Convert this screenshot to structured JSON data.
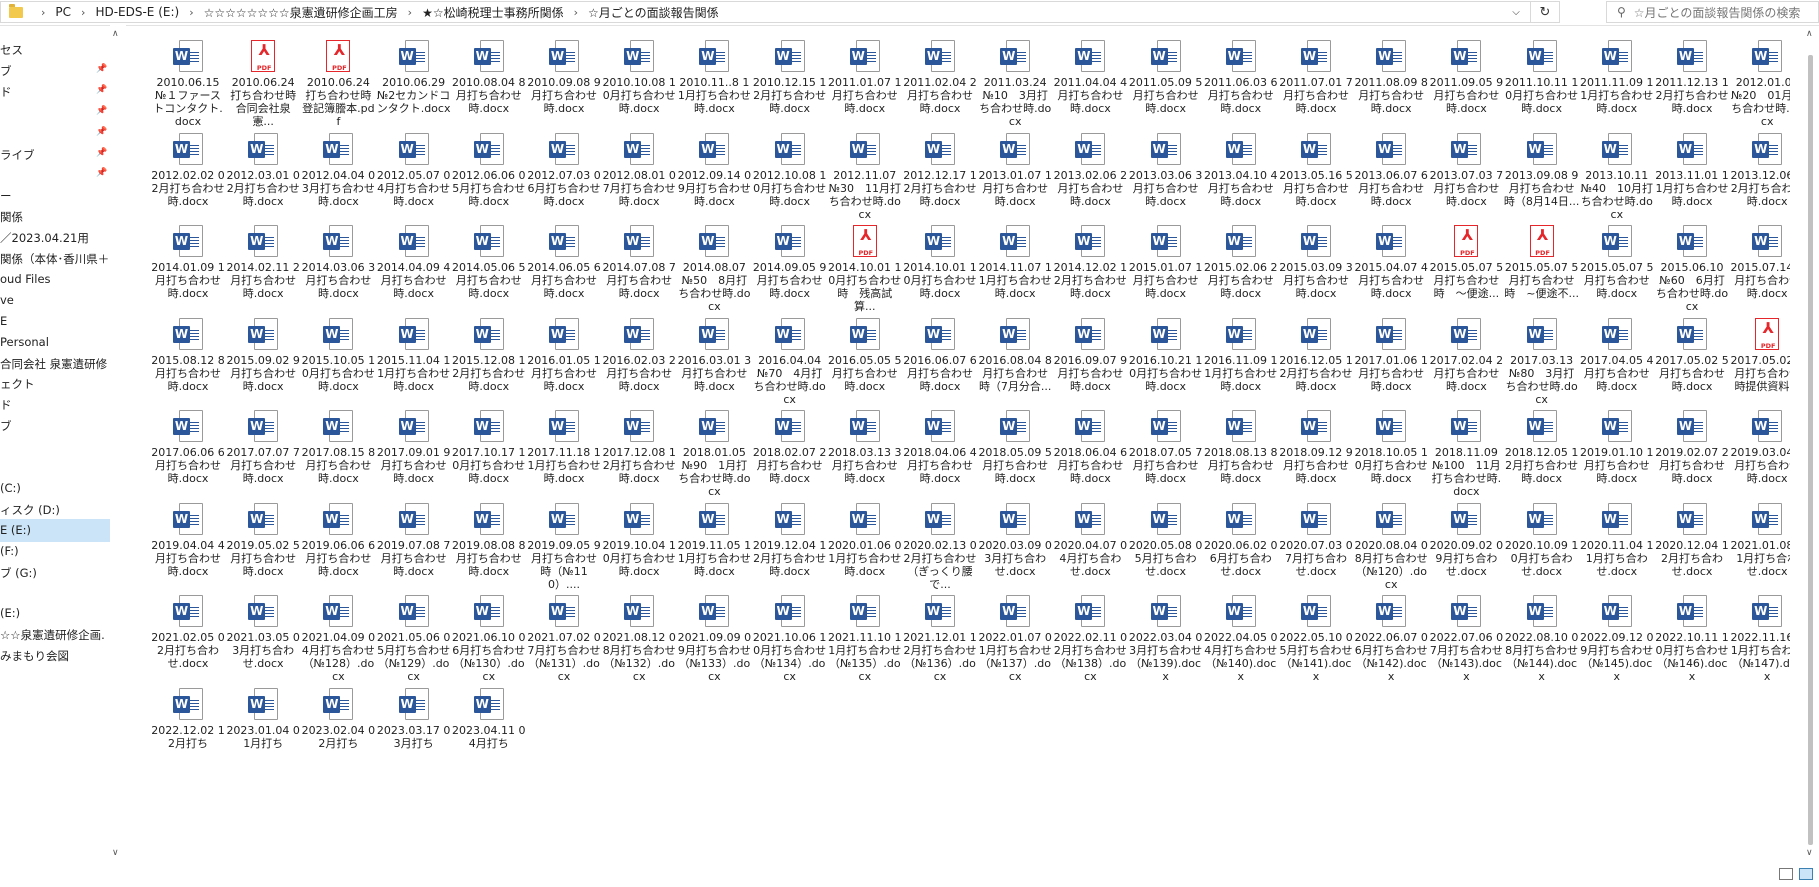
{
  "address": {
    "segments": [
      "PC",
      "HD-EDS-E (E:)",
      "☆☆☆☆☆☆☆☆泉憲遺研修企画工房",
      "★☆松崎税理士事務所関係",
      "☆月ごとの面談報告関係"
    ]
  },
  "search": {
    "placeholder": "☆月ごとの面談報告関係の検索"
  },
  "nav": {
    "items": [
      {
        "label": "セス",
        "pinned": false
      },
      {
        "label": "ブ",
        "pinned": true
      },
      {
        "label": "ド",
        "pinned": true
      },
      {
        "label": "",
        "pinned": true
      },
      {
        "label": "",
        "pinned": true
      },
      {
        "label": "ライブ",
        "pinned": true
      },
      {
        "label": "",
        "pinned": true
      },
      {
        "label": "ー",
        "pinned": false
      },
      {
        "label": "関係",
        "pinned": false
      },
      {
        "label": "／2023.04.21用",
        "pinned": false
      },
      {
        "label": "関係（本体･香川県＋",
        "pinned": false
      },
      {
        "label": "oud Files",
        "pinned": false
      },
      {
        "label": "ve",
        "pinned": false
      },
      {
        "label": "E",
        "pinned": false
      },
      {
        "label": " Personal",
        "pinned": false
      },
      {
        "label": "合同会社 泉憲遺研修",
        "pinned": false
      },
      {
        "label": "ェクト",
        "pinned": false
      },
      {
        "label": "ド",
        "pinned": false
      },
      {
        "label": "ブ",
        "pinned": false
      },
      {
        "label": "",
        "pinned": false
      },
      {
        "label": "",
        "pinned": false
      },
      {
        "label": "(C:)",
        "pinned": false
      },
      {
        "label": "ィスク (D:)",
        "pinned": false
      },
      {
        "label": "E (E:)",
        "pinned": false,
        "selected": true
      },
      {
        "label": "(F:)",
        "pinned": false
      },
      {
        "label": "ブ (G:)",
        "pinned": false
      },
      {
        "label": "",
        "pinned": false
      },
      {
        "label": "(E:)",
        "pinned": false
      },
      {
        "label": "☆☆泉憲遺研修企画.",
        "pinned": false
      },
      {
        "label": "みまもり会図",
        "pinned": false
      }
    ]
  },
  "files": [
    {
      "type": "word",
      "name": "2010.06.15 №１ファーストコンタクト.docx"
    },
    {
      "type": "pdf",
      "name": "2010.06.24 打ち合わせ時　合同会社泉憲..."
    },
    {
      "type": "pdf",
      "name": "2010.06.24 打ち合わせ時　登記簿謄本.pdf"
    },
    {
      "type": "word",
      "name": "2010.06.29 №2セカンドコンタクト.docx"
    },
    {
      "type": "word",
      "name": "2010.08.04 8月打ち合わせ時.docx"
    },
    {
      "type": "word",
      "name": "2010.09.08 9月打ち合わせ時.docx"
    },
    {
      "type": "word",
      "name": "2010.10.08 10月打ち合わせ時.docx"
    },
    {
      "type": "word",
      "name": "2010.11..8 11月打ち合わせ時.docx"
    },
    {
      "type": "word",
      "name": "2010.12.15 12月打ち合わせ時.docx"
    },
    {
      "type": "word",
      "name": "2011.01.07 1月打ち合わせ時.docx"
    },
    {
      "type": "word",
      "name": "2011.02.04 2月打ち合わせ時.docx"
    },
    {
      "type": "word",
      "name": "2011.03.24 №10　3月打ち合わせ時.docx"
    },
    {
      "type": "word",
      "name": "2011.04.04 4月打ち合わせ時.docx"
    },
    {
      "type": "word",
      "name": "2011.05.09 5月打ち合わせ時.docx"
    },
    {
      "type": "word",
      "name": "2011.06.03 6月打ち合わせ時.docx"
    },
    {
      "type": "word",
      "name": "2011.07.01 7月打ち合わせ時.docx"
    },
    {
      "type": "word",
      "name": "2011.08.09 8月打ち合わせ時.docx"
    },
    {
      "type": "word",
      "name": "2011.09.05 9月打ち合わせ時.docx"
    },
    {
      "type": "word",
      "name": "2011.10.11 10月打ち合わせ時.docx"
    },
    {
      "type": "word",
      "name": "2011.11.09 11月打ち合わせ時.docx"
    },
    {
      "type": "word",
      "name": "2011.12.13 12月打ち合わせ時.docx"
    },
    {
      "type": "word",
      "name": "2012.01.04 №20　01月打ち合わせ時.docx"
    },
    {
      "type": "word",
      "name": "2012.02.02 02月打ち合わせ時.docx"
    },
    {
      "type": "word",
      "name": "2012.03.01 02月打ち合わせ時.docx"
    },
    {
      "type": "word",
      "name": "2012.04.04 03月打ち合わせ時.docx"
    },
    {
      "type": "word",
      "name": "2012.05.07 04月打ち合わせ時.docx"
    },
    {
      "type": "word",
      "name": "2012.06.06 05月打ち合わせ時.docx"
    },
    {
      "type": "word",
      "name": "2012.07.03 06月打ち合わせ時.docx"
    },
    {
      "type": "word",
      "name": "2012.08.01 07月打ち合わせ時.docx"
    },
    {
      "type": "word",
      "name": "2012.09.14 09月打ち合わせ時.docx"
    },
    {
      "type": "word",
      "name": "2012.10.08 10月打ち合わせ時.docx"
    },
    {
      "type": "word",
      "name": "2012.11.07 №30　11月打ち合わせ時.docx"
    },
    {
      "type": "word",
      "name": "2012.12.17 12月打ち合わせ時.docx"
    },
    {
      "type": "word",
      "name": "2013.01.07 1月打ち合わせ時.docx"
    },
    {
      "type": "word",
      "name": "2013.02.06 2月打ち合わせ時.docx"
    },
    {
      "type": "word",
      "name": "2013.03.06 3月打ち合わせ時.docx"
    },
    {
      "type": "word",
      "name": "2013.04.10 4月打ち合わせ時.docx"
    },
    {
      "type": "word",
      "name": "2013.05.16 5月打ち合わせ時.docx"
    },
    {
      "type": "word",
      "name": "2013.06.07 6月打ち合わせ時.docx"
    },
    {
      "type": "word",
      "name": "2013.07.03 7月打ち合わせ時.docx"
    },
    {
      "type": "word",
      "name": "2013.09.08 9月打ち合わせ時（8月14日..."
    },
    {
      "type": "word",
      "name": "2013.10.11 №40　10月打ち合わせ時.docx"
    },
    {
      "type": "word",
      "name": "2013.11.01 11月打ち合わせ時.docx"
    },
    {
      "type": "word",
      "name": "2013.12.06 12月打ち合わせ時.docx"
    },
    {
      "type": "word",
      "name": "2014.01.09 1月打ち合わせ時.docx"
    },
    {
      "type": "word",
      "name": "2014.02.11 2月打ち合わせ時.docx"
    },
    {
      "type": "word",
      "name": "2014.03.06 3月打ち合わせ時.docx"
    },
    {
      "type": "word",
      "name": "2014.04.09 4月打ち合わせ時.docx"
    },
    {
      "type": "word",
      "name": "2014.05.06 5月打ち合わせ時.docx"
    },
    {
      "type": "word",
      "name": "2014.06.05 6月打ち合わせ時.docx"
    },
    {
      "type": "word",
      "name": "2014.07.08 7月打ち合わせ時.docx"
    },
    {
      "type": "word",
      "name": "2014.08.07 №50　8月打ち合わせ時.docx"
    },
    {
      "type": "word",
      "name": "2014.09.05 9月打ち合わせ時.docx"
    },
    {
      "type": "pdf",
      "name": "2014.10.01 10月打ち合わせ時　残高試算..."
    },
    {
      "type": "word",
      "name": "2014.10.01 10月打ち合わせ時.docx"
    },
    {
      "type": "word",
      "name": "2014.11.07 11月打ち合わせ時.docx"
    },
    {
      "type": "word",
      "name": "2014.12.02 12月打ち合わせ時.docx"
    },
    {
      "type": "word",
      "name": "2015.01.07 1月打ち合わせ時.docx"
    },
    {
      "type": "word",
      "name": "2015.02.06 2月打ち合わせ時.docx"
    },
    {
      "type": "word",
      "name": "2015.03.09 3月打ち合わせ時.docx"
    },
    {
      "type": "word",
      "name": "2015.04.07 4月打ち合わせ時.docx"
    },
    {
      "type": "pdf",
      "name": "2015.05.07 5月打ち合わせ時　〜便途..."
    },
    {
      "type": "pdf",
      "name": "2015.05.07 5月打ち合わせ時　~便途不..."
    },
    {
      "type": "word",
      "name": "2015.05.07 5月打ち合わせ時.docx"
    },
    {
      "type": "word",
      "name": "2015.06.10 №60　6月打ち合わせ時.docx"
    },
    {
      "type": "word",
      "name": "2015.07.14 7月打ち合わせ時.docx"
    },
    {
      "type": "word",
      "name": "2015.08.12 8月打ち合わせ時.docx"
    },
    {
      "type": "word",
      "name": "2015.09.02 9月打ち合わせ時.docx"
    },
    {
      "type": "word",
      "name": "2015.10.05 10月打ち合わせ時.docx"
    },
    {
      "type": "word",
      "name": "2015.11.04 11月打ち合わせ時.docx"
    },
    {
      "type": "word",
      "name": "2015.12.08 12月打ち合わせ時.docx"
    },
    {
      "type": "word",
      "name": "2016.01.05 1月打ち合わせ時.docx"
    },
    {
      "type": "word",
      "name": "2016.02.03 2月打ち合わせ時.docx"
    },
    {
      "type": "word",
      "name": "2016.03.01 3月打ち合わせ時.docx"
    },
    {
      "type": "word",
      "name": "2016.04.04 №70　4月打ち合わせ時.docx"
    },
    {
      "type": "word",
      "name": "2016.05.05 5月打ち合わせ時.docx"
    },
    {
      "type": "word",
      "name": "2016.06.07 6月打ち合わせ時.docx"
    },
    {
      "type": "word",
      "name": "2016.08.04 8月打ち合わせ時（7月分合..."
    },
    {
      "type": "word",
      "name": "2016.09.07 9月打ち合わせ時.docx"
    },
    {
      "type": "word",
      "name": "2016.10.21 10月打ち合わせ時.docx"
    },
    {
      "type": "word",
      "name": "2016.11.09 11月打ち合わせ時.docx"
    },
    {
      "type": "word",
      "name": "2016.12.05 12月打ち合わせ時.docx"
    },
    {
      "type": "word",
      "name": "2017.01.06 1月打ち合わせ時.docx"
    },
    {
      "type": "word",
      "name": "2017.02.04 2月打ち合わせ時.docx"
    },
    {
      "type": "word",
      "name": "2017.03.13 №80　3月打ち合わせ時.docx"
    },
    {
      "type": "word",
      "name": "2017.04.05 4月打ち合わせ時.docx"
    },
    {
      "type": "word",
      "name": "2017.05.02 5月打ち合わせ時.docx"
    },
    {
      "type": "pdf",
      "name": "2017.05.02 5月打ち合わせ時提供資料..."
    },
    {
      "type": "word",
      "name": "2017.06.06 6月打ち合わせ時.docx"
    },
    {
      "type": "word",
      "name": "2017.07.07 7月打ち合わせ時.docx"
    },
    {
      "type": "word",
      "name": "2017.08.15 8月打ち合わせ時.docx"
    },
    {
      "type": "word",
      "name": "2017.09.01 9月打ち合わせ時.docx"
    },
    {
      "type": "word",
      "name": "2017.10.17 10月打ち合わせ時.docx"
    },
    {
      "type": "word",
      "name": "2017.11.18 11月打ち合わせ時.docx"
    },
    {
      "type": "word",
      "name": "2017.12.08 12月打ち合わせ時.docx"
    },
    {
      "type": "word",
      "name": "2018.01.05 №90　1月打ち合わせ時.docx"
    },
    {
      "type": "word",
      "name": "2018.02.07 2月打ち合わせ時.docx"
    },
    {
      "type": "word",
      "name": "2018.03.13 3月打ち合わせ時.docx"
    },
    {
      "type": "word",
      "name": "2018.04.06 4月打ち合わせ時.docx"
    },
    {
      "type": "word",
      "name": "2018.05.09 5月打ち合わせ時.docx"
    },
    {
      "type": "word",
      "name": "2018.06.04 6月打ち合わせ時.docx"
    },
    {
      "type": "word",
      "name": "2018.07.05 7月打ち合わせ時.docx"
    },
    {
      "type": "word",
      "name": "2018.08.13 8月打ち合わせ時.docx"
    },
    {
      "type": "word",
      "name": "2018.09.12 9月打ち合わせ時.docx"
    },
    {
      "type": "word",
      "name": "2018.10.05 10月打ち合わせ時.docx"
    },
    {
      "type": "word",
      "name": "2018.11.09 №100　11月打ち合わせ時.docx"
    },
    {
      "type": "word",
      "name": "2018.12.05 12月打ち合わせ時.docx"
    },
    {
      "type": "word",
      "name": "2019.01.10 1月打ち合わせ時.docx"
    },
    {
      "type": "word",
      "name": "2019.02.07 2月打ち合わせ時.docx"
    },
    {
      "type": "word",
      "name": "2019.03.04 3月打ち合わせ時.docx"
    },
    {
      "type": "word",
      "name": "2019.04.04 4月打ち合わせ時.docx"
    },
    {
      "type": "word",
      "name": "2019.05.02 5月打ち合わせ時.docx"
    },
    {
      "type": "word",
      "name": "2019.06.06 6月打ち合わせ時.docx"
    },
    {
      "type": "word",
      "name": "2019.07.08 7月打ち合わせ時.docx"
    },
    {
      "type": "word",
      "name": "2019.08.08 8月打ち合わせ時.docx"
    },
    {
      "type": "word",
      "name": "2019.09.05 9月打ち合わせ時（№110）...."
    },
    {
      "type": "word",
      "name": "2019.10.04 10月打ち合わせ時.docx"
    },
    {
      "type": "word",
      "name": "2019.11.05 11月打ち合わせ時.docx"
    },
    {
      "type": "word",
      "name": "2019.12.04 12月打ち合わせ時.docx"
    },
    {
      "type": "word",
      "name": "2020.01.06 01月打ち合わせ時.docx"
    },
    {
      "type": "word",
      "name": "2020.02.13 02月打ち合わせ（ぎっくり腰で..."
    },
    {
      "type": "word",
      "name": "2020.03.09 03月打ち合わせ.docx"
    },
    {
      "type": "word",
      "name": "2020.04.07 04月打ち合わせ.docx"
    },
    {
      "type": "word",
      "name": "2020.05.08 05月打ち合わせ.docx"
    },
    {
      "type": "word",
      "name": "2020.06.02 06月打ち合わせ.docx"
    },
    {
      "type": "word",
      "name": "2020.07.03 07月打ち合わせ.docx"
    },
    {
      "type": "word",
      "name": "2020.08.04 08月打ち合わせ（№120）.docx"
    },
    {
      "type": "word",
      "name": "2020.09.02 09月打ち合わせ.docx"
    },
    {
      "type": "word",
      "name": "2020.10.09 10月打ち合わせ.docx"
    },
    {
      "type": "word",
      "name": "2020.11.04 11月打ち合わせ.docx"
    },
    {
      "type": "word",
      "name": "2020.12.04 12月打ち合わせ.docx"
    },
    {
      "type": "word",
      "name": "2021.01.08 01月打ち合わせ.docx"
    },
    {
      "type": "word",
      "name": "2021.02.05 02月打ち合わせ.docx"
    },
    {
      "type": "word",
      "name": "2021.03.05 03月打ち合わせ.docx"
    },
    {
      "type": "word",
      "name": "2021.04.09 04月打ち合わせ（№128）.docx"
    },
    {
      "type": "word",
      "name": "2021.05.06 05月打ち合わせ（№129）.docx"
    },
    {
      "type": "word",
      "name": "2021.06.10 06月打ち合わせ（№130）.docx"
    },
    {
      "type": "word",
      "name": "2021.07.02 07月打ち合わせ（№131）.docx"
    },
    {
      "type": "word",
      "name": "2021.08.12 08月打ち合わせ（№132）.docx"
    },
    {
      "type": "word",
      "name": "2021.09.09 09月打ち合わせ（№133）.docx"
    },
    {
      "type": "word",
      "name": "2021.10.06 10月打ち合わせ（№134）.docx"
    },
    {
      "type": "word",
      "name": "2021.11.10 11月打ち合わせ（№135）.docx"
    },
    {
      "type": "word",
      "name": "2021.12.01 12月打ち合わせ（№136）.docx"
    },
    {
      "type": "word",
      "name": "2022.01.07 01月打ち合わせ（№137）.docx"
    },
    {
      "type": "word",
      "name": "2022.02.11 02月打ち合わせ（№138）.docx"
    },
    {
      "type": "word",
      "name": "2022.03.04 03月打ち合わせ（№139).docx"
    },
    {
      "type": "word",
      "name": "2022.04.05 04月打ち合わせ（№140).docx"
    },
    {
      "type": "word",
      "name": "2022.05.10 05月打ち合わせ（№141).docx"
    },
    {
      "type": "word",
      "name": "2022.06.07 06月打ち合わせ（№142).docx"
    },
    {
      "type": "word",
      "name": "2022.07.06 07月打ち合わせ（№143).docx"
    },
    {
      "type": "word",
      "name": "2022.08.10 08月打ち合わせ（№144).docx"
    },
    {
      "type": "word",
      "name": "2022.09.12 09月打ち合わせ（№145).docx"
    },
    {
      "type": "word",
      "name": "2022.10.11 10月打ち合わせ（№146).docx"
    },
    {
      "type": "word",
      "name": "2022.11.16 11月打ち合わせ（№147).docx"
    },
    {
      "type": "word",
      "name": "2022.12.02 12月打ち"
    },
    {
      "type": "word",
      "name": "2023.01.04 01月打ち"
    },
    {
      "type": "word",
      "name": "2023.02.04 02月打ち"
    },
    {
      "type": "word",
      "name": "2023.03.17 03月打ち"
    },
    {
      "type": "word",
      "name": "2023.04.11 04月打ち"
    }
  ]
}
